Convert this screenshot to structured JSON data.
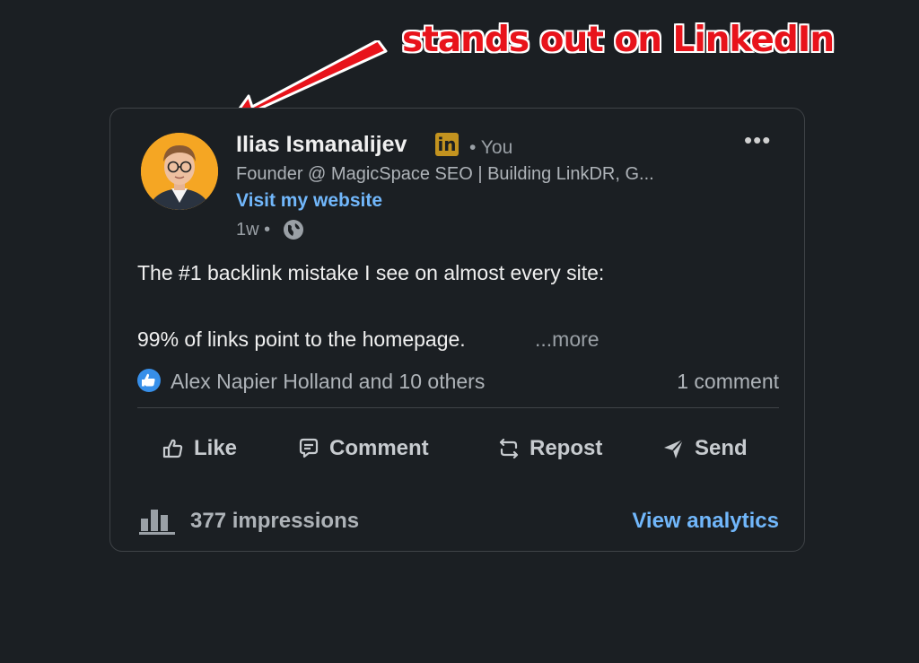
{
  "annotation": {
    "text": "stands out on LinkedIn",
    "color": "#e8131b"
  },
  "post": {
    "author": {
      "name": "Ilias Ismanalijev",
      "badge": "in",
      "degree": "• You",
      "headline": "Founder @ MagicSpace SEO | Building LinkDR, G...",
      "website_label": "Visit my website",
      "time": "1w •",
      "visibility_icon": "globe-icon"
    },
    "text": {
      "line1": "The #1 backlink mistake I see on almost every site:",
      "line2": "99% of links point to the homepage.",
      "see_more": "...more"
    },
    "social": {
      "reactors": "Alex Napier Holland and 10 others",
      "comments": "1 comment"
    },
    "actions": {
      "like": "Like",
      "comment": "Comment",
      "repost": "Repost",
      "send": "Send"
    },
    "analytics": {
      "impressions": "377 impressions",
      "view_analytics": "View analytics"
    }
  },
  "colors": {
    "background": "#1b1f23",
    "link": "#71b7fb",
    "badge": "#c3931f",
    "avatar_bg": "#f5a623"
  }
}
